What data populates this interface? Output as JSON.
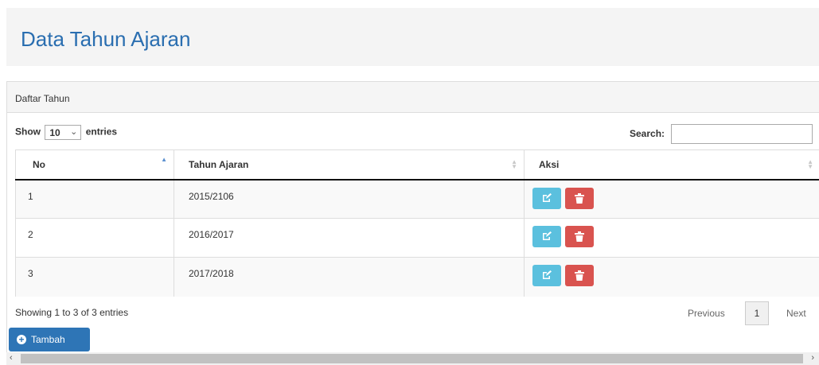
{
  "header": {
    "title": "Data Tahun Ajaran"
  },
  "panel": {
    "heading": "Daftar Tahun"
  },
  "length": {
    "prefix": "Show",
    "value": "10",
    "suffix": "entries"
  },
  "search": {
    "label": "Search:",
    "value": ""
  },
  "table": {
    "columns": [
      "No",
      "Tahun Ajaran",
      "Aksi"
    ],
    "rows": [
      {
        "no": "1",
        "tahun": "2015/2106"
      },
      {
        "no": "2",
        "tahun": "2016/2017"
      },
      {
        "no": "3",
        "tahun": "2017/2018"
      }
    ]
  },
  "info": "Showing 1 to 3 of 3 entries",
  "pagination": {
    "previous": "Previous",
    "current": "1",
    "next": "Next"
  },
  "buttons": {
    "add": "Tambah"
  },
  "colors": {
    "title": "#2a6eb0",
    "edit": "#5bc0de",
    "delete": "#d9534f",
    "primary": "#2e75b6"
  }
}
